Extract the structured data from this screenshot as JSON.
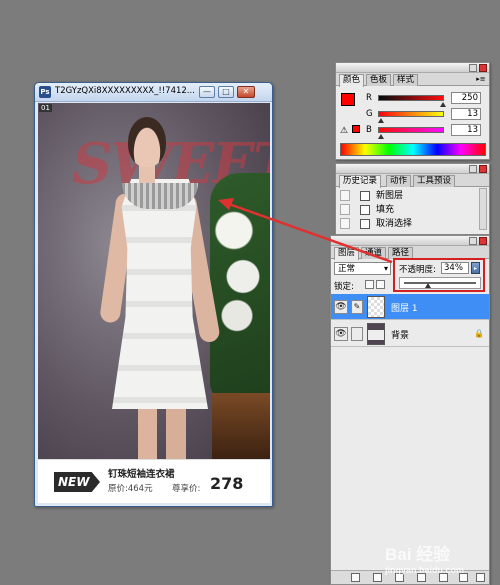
{
  "document_window": {
    "title": "T2GYzQXi8XXXXXXXXX_!!7412...",
    "canvas_label": "01",
    "photo_text": "SWEET",
    "new_badge": "NEW",
    "product_name": "钉珠短袖连衣裙",
    "original_price": "原价:464元",
    "member_price_label": "尊享价:",
    "member_price": "278",
    "buttons": {
      "minimize": "—",
      "maximize": "□",
      "close": "✕"
    }
  },
  "color_palette": {
    "tabs": [
      "颜色",
      "色板",
      "样式"
    ],
    "active_tab": "颜色",
    "channels": [
      {
        "label": "R",
        "value": "250",
        "fraction": 0.98
      },
      {
        "label": "G",
        "value": "13",
        "fraction": 0.05
      },
      {
        "label": "B",
        "value": "13",
        "fraction": 0.05
      }
    ],
    "foreground_color": "#ff0000",
    "warning_icon": "⚠"
  },
  "history_palette": {
    "tabs": [
      "历史记录",
      "动作",
      "工具预设"
    ],
    "active_tab": "历史记录",
    "items": [
      "新图层",
      "填充",
      "取消选择"
    ]
  },
  "layers_palette": {
    "tabs": [
      "图层",
      "通道",
      "路径"
    ],
    "active_tab": "图层",
    "blend_mode": "正常",
    "opacity_label": "不透明度:",
    "opacity_value": "34%",
    "opacity_fraction": 0.34,
    "lock_label": "锁定:",
    "layers": [
      {
        "name": "图层 1",
        "selected": true,
        "visible": true
      },
      {
        "name": "背景",
        "selected": false,
        "visible": true,
        "locked": true
      }
    ]
  },
  "watermark": {
    "main": "Bai 经验",
    "sub": "jingyan.baidu.com"
  },
  "colors": {
    "highlight": "#d42020",
    "selection": "#3f8ef5",
    "arrow": "#e03030"
  }
}
